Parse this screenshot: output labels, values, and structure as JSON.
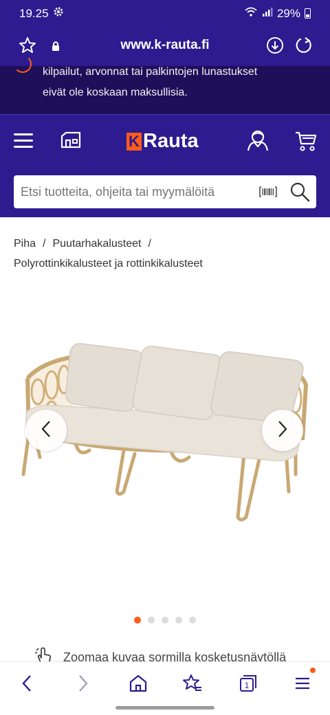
{
  "status_bar": {
    "time": "19.25",
    "battery": "29%",
    "icons": [
      "gear-icon",
      "wifi-icon",
      "signal-icon",
      "battery-icon"
    ]
  },
  "browser": {
    "url": "www.k-rauta.fi",
    "icons": [
      "star-icon",
      "lock-icon",
      "download-icon",
      "reload-icon"
    ]
  },
  "notice": {
    "line1": "kilpailut, arvonnat tai palkintojen lunastukset",
    "line2": "eivät ole koskaan maksullisia."
  },
  "header": {
    "logo_mark": "K",
    "logo_text": "Rauta",
    "icons": [
      "menu-icon",
      "store-icon",
      "account-icon",
      "cart-icon"
    ]
  },
  "search": {
    "placeholder": "Etsi tuotteita, ohjeita tai myymälöitä",
    "icons": [
      "barcode-icon",
      "search-icon"
    ]
  },
  "breadcrumb": {
    "items": [
      "Piha",
      "Puutarhakalusteet",
      "Polyrottinkikalusteet ja rottinkikalusteet"
    ],
    "separator": "/"
  },
  "gallery": {
    "image_count": 5,
    "active_index": 0,
    "zoom_hint": "Zoomaa kuvaa sormilla kosketusnäytöllä"
  },
  "colors": {
    "brand_purple": "#2d1b8f",
    "notice_purple": "#1e0f5a",
    "accent_orange": "#ff5b1a"
  },
  "bottom_nav": {
    "icons": [
      "back-icon",
      "forward-icon",
      "home-icon",
      "bookmarks-icon",
      "tabs-icon",
      "menu-icon"
    ],
    "tab_count": "1"
  }
}
